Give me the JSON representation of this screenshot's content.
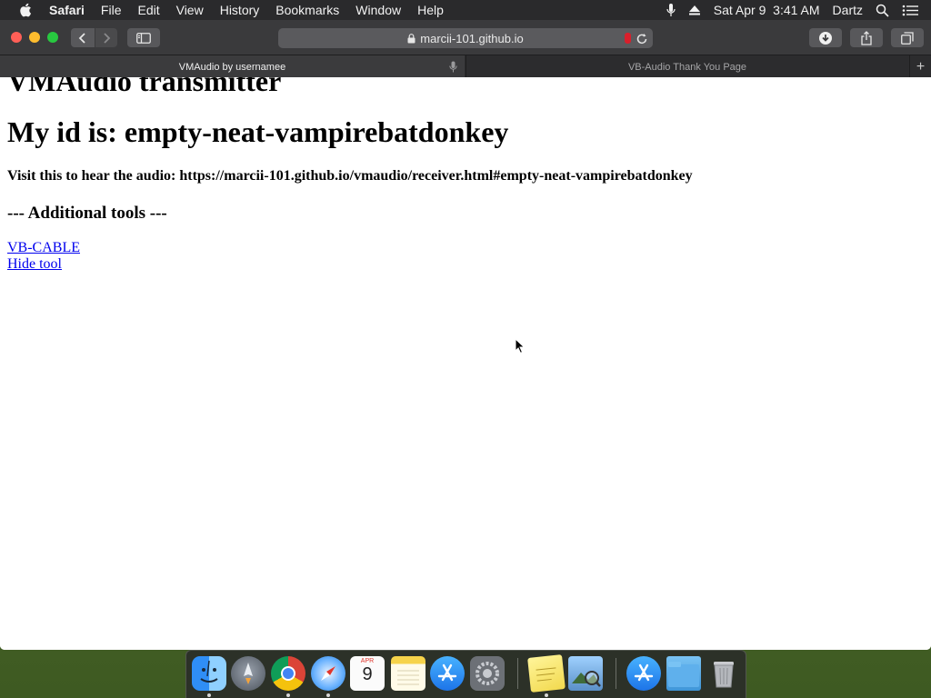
{
  "menubar": {
    "app_name": "Safari",
    "items": [
      "File",
      "Edit",
      "View",
      "History",
      "Bookmarks",
      "Window",
      "Help"
    ],
    "clock": "Sat Apr 9  3:41 AM",
    "user": "Dartz"
  },
  "browser": {
    "url": "marcii-101.github.io",
    "tabs": [
      {
        "title": "VMAudio by usernamee",
        "active": true
      },
      {
        "title": "VB-Audio Thank You Page",
        "active": false
      }
    ],
    "new_tab_label": "+"
  },
  "page": {
    "heading_clipped": "VMAudio transmitter",
    "heading_id": "My id is: empty-neat-vampirebatdonkey",
    "visit_text": "Visit this to hear the audio: https://marcii-101.github.io/vmaudio/receiver.html#empty-neat-vampirebatdonkey",
    "tools_heading": "--- Additional tools ---",
    "links": [
      "VB-CABLE",
      "Hide tool"
    ]
  },
  "dock": {
    "calendar_month": "APR",
    "calendar_day": "9",
    "apps": [
      "finder-icon",
      "launchpad-icon",
      "chrome-icon",
      "safari-icon",
      "calendar-icon",
      "notes-icon",
      "app-store-icon",
      "system-preferences-icon",
      "stickies-icon",
      "preview-icon",
      "app-store-folder-icon",
      "downloads-folder-icon",
      "trash-icon"
    ]
  },
  "colors": {
    "link": "#0000ee",
    "menubar": "#2a2a2c",
    "toolbar": "#3a3a3c",
    "close": "#ff5f57",
    "minimize": "#febc2e",
    "maximize": "#28c840"
  }
}
